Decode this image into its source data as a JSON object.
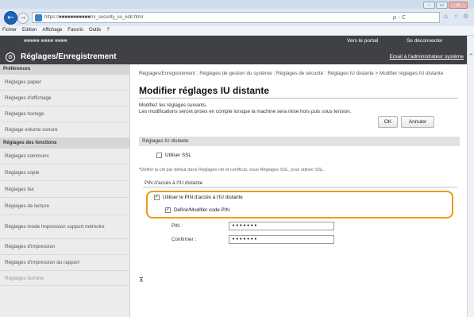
{
  "browser": {
    "address": "https://■■■■■■■■■■■/rv_security_iui_edit.html",
    "search_hint": "ρ - C",
    "window_buttons": [
      "–",
      "▭",
      "✕"
    ],
    "menu": [
      "Fichier",
      "Edition",
      "Affichage",
      "Favoris",
      "Outils",
      "?"
    ]
  },
  "header": {
    "top_left": "■■■■■  ■■■■  ■■■■",
    "portal_link": "Vers le portail",
    "logout_link": "Se déconnecter",
    "title": "Réglages/Enregistrement",
    "email_link": "Email à l'administrateur système"
  },
  "sidebar": {
    "section1": "Préférences",
    "items1": [
      "Réglages papier",
      "Réglages d'affichage",
      "Réglages horloge",
      "Réglage volume sonore"
    ],
    "section2": "Réglages des fonctions",
    "items2": [
      "Réglages communs",
      "Réglages copie",
      "Réglages fax",
      "Réglages de lecture",
      "Réglages mode Impression support mémoire",
      "Réglages d'impression",
      "Réglages d'impression du rapport",
      "Réglages fax/nrle"
    ]
  },
  "main": {
    "breadcrumb": "Réglages/Enregistrement : Réglages de gestion du système : Réglages de sécurité : Réglages IU distante > Modifier réglages IU distante",
    "title": "Modifier réglages IU distante",
    "desc_line1": "Modifiez les réglages suivants.",
    "desc_line2": "Les modifications seront prises en compte lorsque la machine sera mise hors puis sous tension.",
    "ok_label": "OK",
    "cancel_label": "Annuler",
    "section_title": "Réglages IU distante",
    "use_ssl_label": "Utiliser SSL",
    "use_ssl_checked": false,
    "ssl_note": "*Définir la clé par défaut dans Réglages clé et certificat, sous Réglages SSL, pour utiliser SSL.",
    "pin_section_title": "PIN d'accès à l'IU distante",
    "use_pin_label": "Utiliser le PIN d'accès à l'IU distante",
    "use_pin_checked": true,
    "set_pin_label": "Définir/Modifier code PIN",
    "set_pin_checked": true,
    "pin_label": "PIN :",
    "pin_value": "•••••••",
    "confirm_label": "Confirmer :",
    "confirm_value": "•••••••",
    "top_arrow": "⊼"
  }
}
